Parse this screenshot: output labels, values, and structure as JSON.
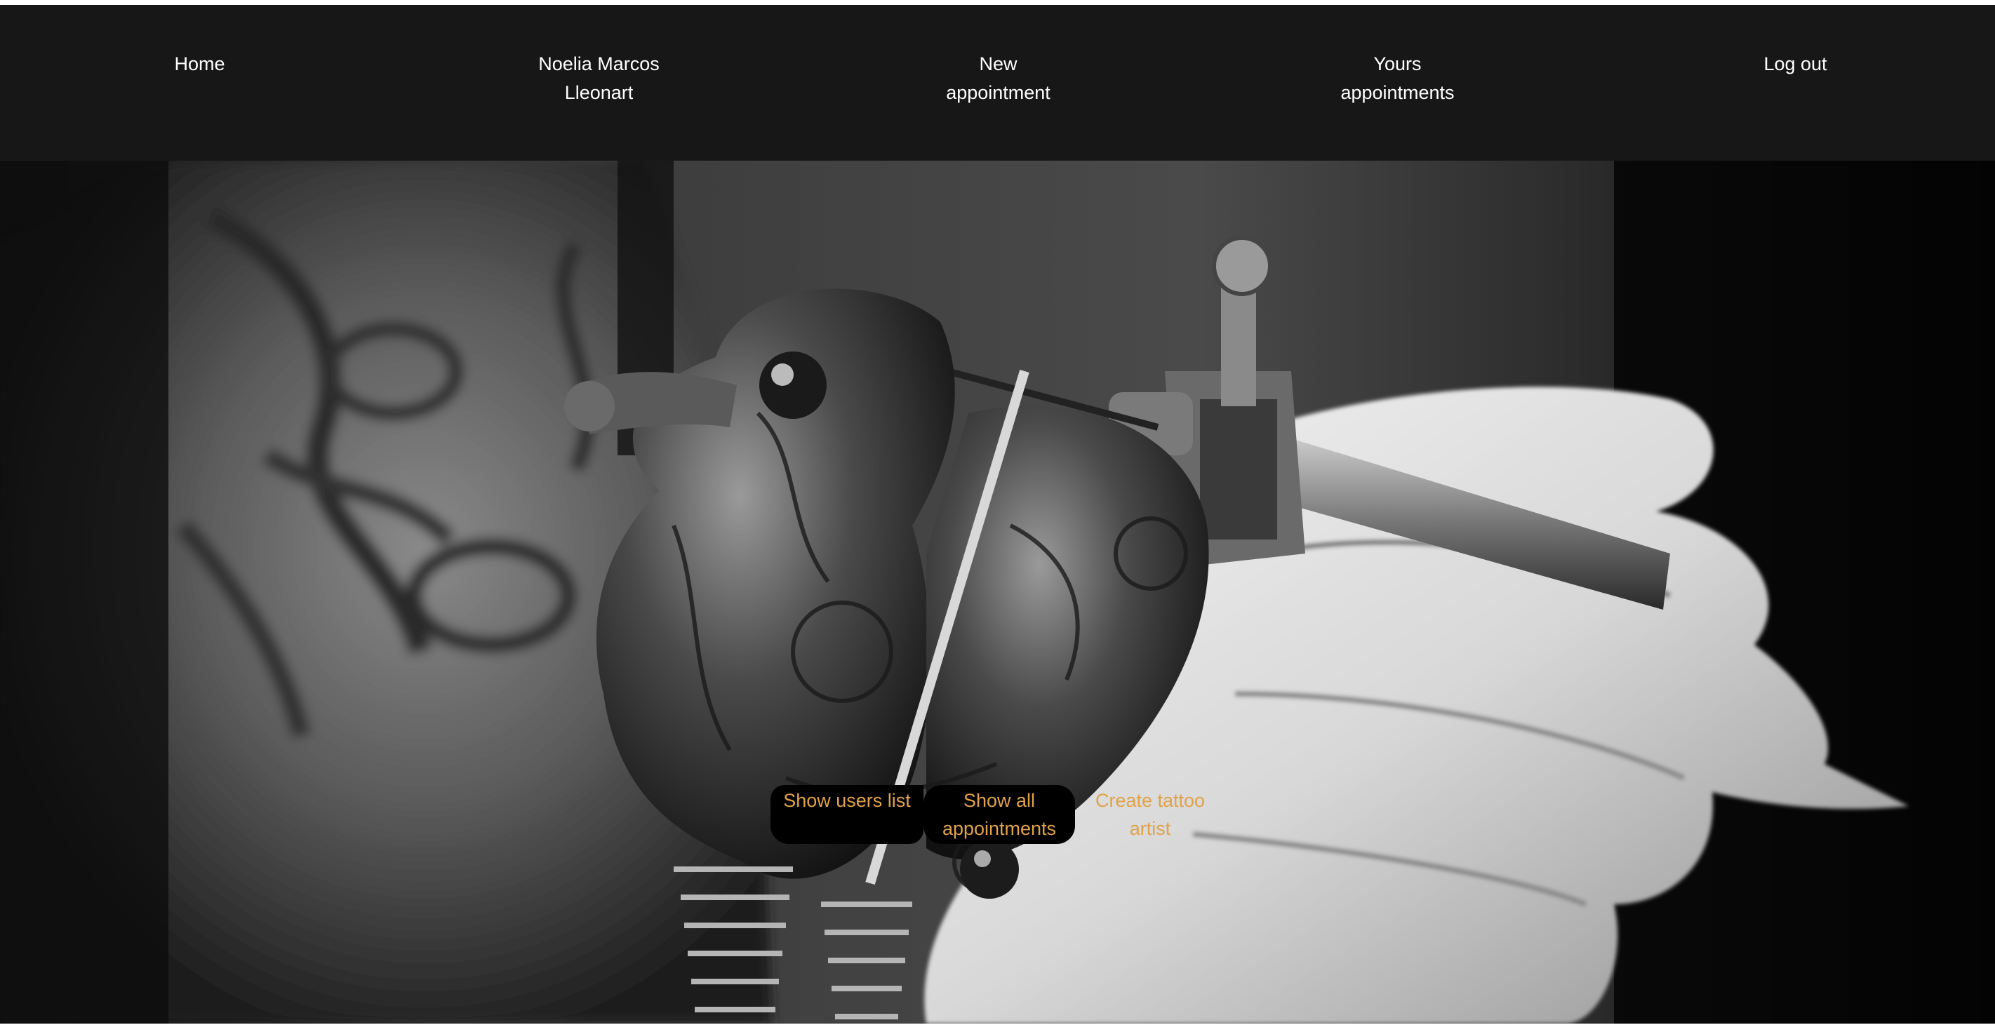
{
  "navbar": {
    "items": [
      {
        "label": "Home"
      },
      {
        "label": "Noelia Marcos Lleonart"
      },
      {
        "label": "New appointment"
      },
      {
        "label": "Yours appointments"
      },
      {
        "label": "Log out"
      }
    ]
  },
  "admin_actions": {
    "show_users": "Show users list",
    "show_appointments": "Show all appointments",
    "create_artist": "Create tattoo artist"
  },
  "colors": {
    "navbar_bg": "#171717",
    "nav_text": "#ffffff",
    "button_bg": "#000000",
    "button_text": "#e0a24a"
  },
  "hero": {
    "image": "tattoo-machine-photo"
  }
}
